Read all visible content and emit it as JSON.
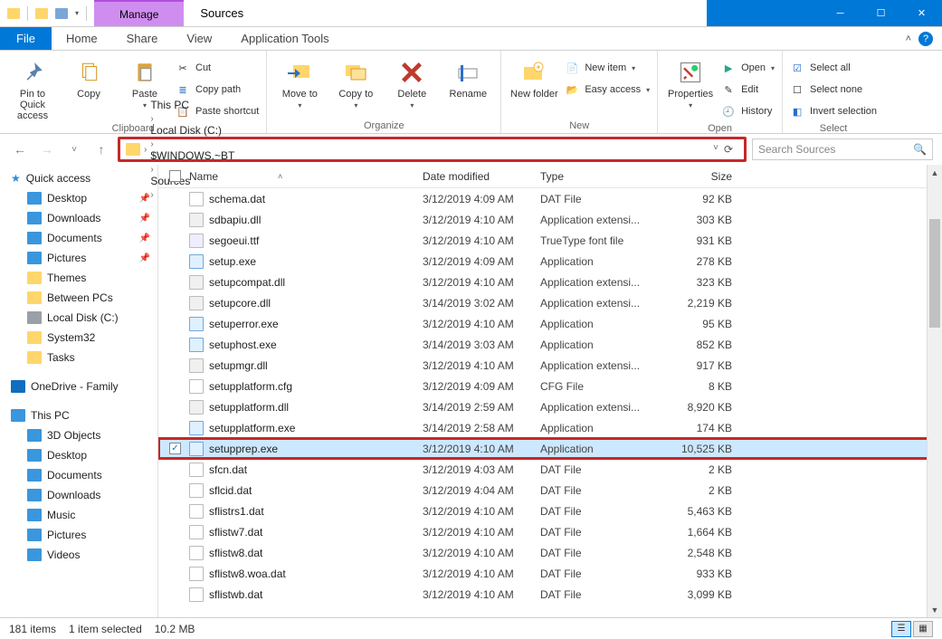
{
  "titlebar": {
    "manage": "Manage",
    "title": "Sources"
  },
  "tabs": {
    "file": "File",
    "home": "Home",
    "share": "Share",
    "view": "View",
    "apptools": "Application Tools"
  },
  "ribbon": {
    "clipboard": {
      "pin": "Pin to Quick access",
      "copy": "Copy",
      "paste": "Paste",
      "cut": "Cut",
      "copypath": "Copy path",
      "pasteshortcut": "Paste shortcut",
      "label": "Clipboard"
    },
    "organize": {
      "moveto": "Move to",
      "copyto": "Copy to",
      "delete": "Delete",
      "rename": "Rename",
      "label": "Organize"
    },
    "new": {
      "newfolder": "New folder",
      "newitem": "New item",
      "easyaccess": "Easy access",
      "label": "New"
    },
    "open": {
      "properties": "Properties",
      "open": "Open",
      "edit": "Edit",
      "history": "History",
      "label": "Open"
    },
    "select": {
      "selectall": "Select all",
      "selectnone": "Select none",
      "invert": "Invert selection",
      "label": "Select"
    }
  },
  "breadcrumb": [
    "This PC",
    "Local Disk (C:)",
    "$WINDOWS.~BT",
    "Sources"
  ],
  "search_placeholder": "Search Sources",
  "tree": {
    "quickaccess": "Quick access",
    "qa_items": [
      {
        "label": "Desktop",
        "pin": true,
        "cls": "ic-desktop"
      },
      {
        "label": "Downloads",
        "pin": true,
        "cls": "ic-dl"
      },
      {
        "label": "Documents",
        "pin": true,
        "cls": "ic-doc"
      },
      {
        "label": "Pictures",
        "pin": true,
        "cls": "ic-pic"
      },
      {
        "label": "Themes",
        "pin": false,
        "cls": "ic-folder"
      },
      {
        "label": "Between PCs",
        "pin": false,
        "cls": "ic-folder"
      },
      {
        "label": "Local Disk (C:)",
        "pin": false,
        "cls": "ic-drive"
      },
      {
        "label": "System32",
        "pin": false,
        "cls": "ic-folder"
      },
      {
        "label": "Tasks",
        "pin": false,
        "cls": "ic-folder"
      }
    ],
    "onedrive": "OneDrive - Family",
    "thispc": "This PC",
    "pc_items": [
      {
        "label": "3D Objects",
        "cls": "ic-pc"
      },
      {
        "label": "Desktop",
        "cls": "ic-desktop"
      },
      {
        "label": "Documents",
        "cls": "ic-doc"
      },
      {
        "label": "Downloads",
        "cls": "ic-dl"
      },
      {
        "label": "Music",
        "cls": "ic-music"
      },
      {
        "label": "Pictures",
        "cls": "ic-pic"
      },
      {
        "label": "Videos",
        "cls": "ic-video"
      }
    ]
  },
  "columns": {
    "name": "Name",
    "date": "Date modified",
    "type": "Type",
    "size": "Size"
  },
  "files": [
    {
      "n": "schema.dat",
      "d": "3/12/2019 4:09 AM",
      "t": "DAT File",
      "s": "92 KB",
      "ic": ""
    },
    {
      "n": "sdbapiu.dll",
      "d": "3/12/2019 4:10 AM",
      "t": "Application extensi...",
      "s": "303 KB",
      "ic": "dll"
    },
    {
      "n": "segoeui.ttf",
      "d": "3/12/2019 4:10 AM",
      "t": "TrueType font file",
      "s": "931 KB",
      "ic": "ttf"
    },
    {
      "n": "setup.exe",
      "d": "3/12/2019 4:09 AM",
      "t": "Application",
      "s": "278 KB",
      "ic": "exe"
    },
    {
      "n": "setupcompat.dll",
      "d": "3/12/2019 4:10 AM",
      "t": "Application extensi...",
      "s": "323 KB",
      "ic": "dll"
    },
    {
      "n": "setupcore.dll",
      "d": "3/14/2019 3:02 AM",
      "t": "Application extensi...",
      "s": "2,219 KB",
      "ic": "dll"
    },
    {
      "n": "setuperror.exe",
      "d": "3/12/2019 4:10 AM",
      "t": "Application",
      "s": "95 KB",
      "ic": "exe"
    },
    {
      "n": "setuphost.exe",
      "d": "3/14/2019 3:03 AM",
      "t": "Application",
      "s": "852 KB",
      "ic": "exe"
    },
    {
      "n": "setupmgr.dll",
      "d": "3/12/2019 4:10 AM",
      "t": "Application extensi...",
      "s": "917 KB",
      "ic": "dll"
    },
    {
      "n": "setupplatform.cfg",
      "d": "3/12/2019 4:09 AM",
      "t": "CFG File",
      "s": "8 KB",
      "ic": ""
    },
    {
      "n": "setupplatform.dll",
      "d": "3/14/2019 2:59 AM",
      "t": "Application extensi...",
      "s": "8,920 KB",
      "ic": "dll"
    },
    {
      "n": "setupplatform.exe",
      "d": "3/14/2019 2:58 AM",
      "t": "Application",
      "s": "174 KB",
      "ic": "exe"
    },
    {
      "n": "setupprep.exe",
      "d": "3/12/2019 4:10 AM",
      "t": "Application",
      "s": "10,525 KB",
      "ic": "exe",
      "sel": true,
      "hl": true
    },
    {
      "n": "sfcn.dat",
      "d": "3/12/2019 4:03 AM",
      "t": "DAT File",
      "s": "2 KB",
      "ic": ""
    },
    {
      "n": "sflcid.dat",
      "d": "3/12/2019 4:04 AM",
      "t": "DAT File",
      "s": "2 KB",
      "ic": ""
    },
    {
      "n": "sflistrs1.dat",
      "d": "3/12/2019 4:10 AM",
      "t": "DAT File",
      "s": "5,463 KB",
      "ic": ""
    },
    {
      "n": "sflistw7.dat",
      "d": "3/12/2019 4:10 AM",
      "t": "DAT File",
      "s": "1,664 KB",
      "ic": ""
    },
    {
      "n": "sflistw8.dat",
      "d": "3/12/2019 4:10 AM",
      "t": "DAT File",
      "s": "2,548 KB",
      "ic": ""
    },
    {
      "n": "sflistw8.woa.dat",
      "d": "3/12/2019 4:10 AM",
      "t": "DAT File",
      "s": "933 KB",
      "ic": ""
    },
    {
      "n": "sflistwb.dat",
      "d": "3/12/2019 4:10 AM",
      "t": "DAT File",
      "s": "3,099 KB",
      "ic": ""
    }
  ],
  "status": {
    "items": "181 items",
    "selected": "1 item selected",
    "size": "10.2 MB"
  }
}
